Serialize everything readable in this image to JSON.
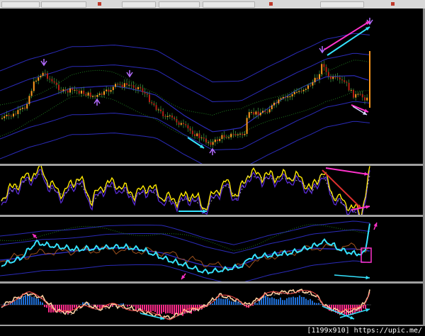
{
  "footer": {
    "dimensions": "[1199x910]",
    "source": "https://upic.me/"
  },
  "colors": {
    "background": "#000000",
    "separator": "#a0a0a0",
    "candle_up": "#ff9a1f",
    "candle_down": "#b32015",
    "candle_wick": "#3b8f3b",
    "band": "#2b2bb8",
    "band_dotted": "#1f7a1f",
    "indicator_yellow": "#ffea00",
    "indicator_cyan": "#35e3ff",
    "indicator_purple": "#5a2bd8",
    "divergence_magenta": "#ff33cc",
    "divergence_red": "#e03030",
    "histogram_blue": "#1f6fd6",
    "histogram_magenta": "#ff2a8a",
    "oscillator_peach": "#ffd0a0",
    "oscillator_red": "#ff4d4d",
    "marker_purple": "#b46cff"
  },
  "chart_data": [
    {
      "type": "line",
      "panel": "price",
      "series": [],
      "overlays": [
        "bollinger-bands",
        "moving-average",
        "fractal-arrows"
      ],
      "annotations": [
        "divergence-arrows"
      ],
      "grid": false
    },
    {
      "type": "line",
      "panel": "oscillator",
      "series": [],
      "annotations": [
        "divergence-lines"
      ],
      "grid": false
    },
    {
      "type": "line",
      "panel": "indicator-with-bands",
      "series": [],
      "annotations": [
        "highlight-box"
      ],
      "grid": false
    },
    {
      "type": "bar",
      "panel": "histogram-oscillator",
      "series": [],
      "grid": false
    }
  ]
}
